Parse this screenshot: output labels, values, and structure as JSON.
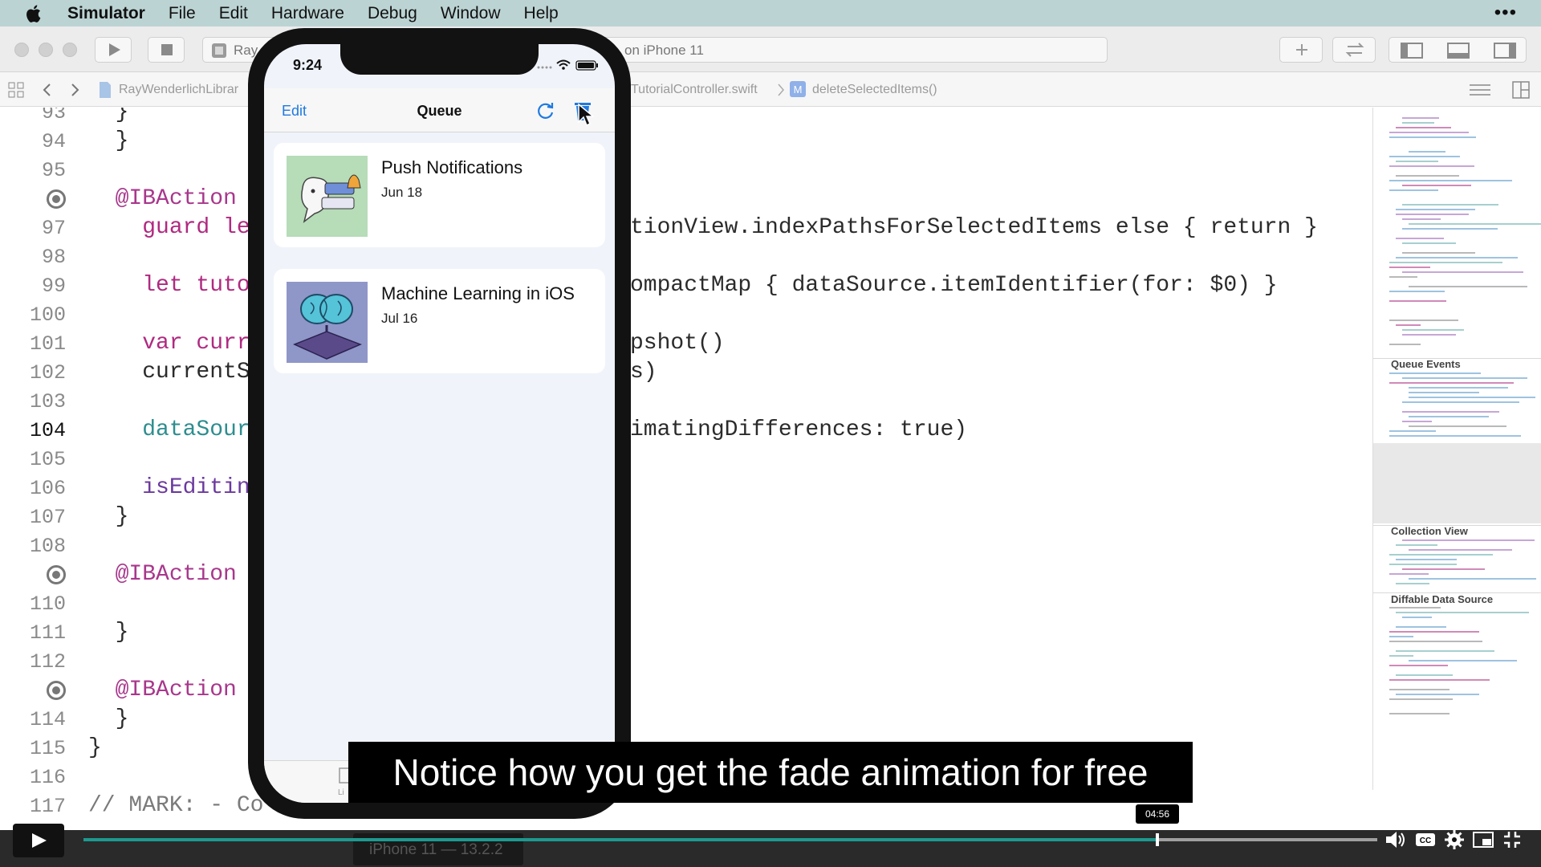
{
  "menubar": {
    "app": "Simulator",
    "items": [
      "File",
      "Edit",
      "Hardware",
      "Debug",
      "Window",
      "Help"
    ]
  },
  "toolbar": {
    "scheme_left": "Ray",
    "scheme_right": "on iPhone 11"
  },
  "jumpbar": {
    "project": "RayWenderlichLibrar",
    "file": "TutorialController.swift",
    "method": "deleteSelectedItems()"
  },
  "editor": {
    "lines": [
      {
        "num": "93",
        "code": "  }",
        "current": false
      },
      {
        "num": "94",
        "code": "  }",
        "current": false
      },
      {
        "num": "95",
        "code": "",
        "current": false
      },
      {
        "num": "96",
        "code": "  @IBAction",
        "current": false,
        "breakpoint": true
      },
      {
        "num": "97",
        "code": "    guard le",
        "tail": "tionView.indexPathsForSelectedItems else { return }",
        "current": false
      },
      {
        "num": "98",
        "code": "",
        "current": false
      },
      {
        "num": "99",
        "code": "    let tuto",
        "tail": "ompactMap { dataSource.itemIdentifier(for: $0) }",
        "current": false
      },
      {
        "num": "100",
        "code": "",
        "current": false
      },
      {
        "num": "101",
        "code": "    var curr",
        "tail": "pshot()",
        "current": false
      },
      {
        "num": "102",
        "code": "    currentS",
        "tail": "s)",
        "current": false
      },
      {
        "num": "103",
        "code": "",
        "current": false
      },
      {
        "num": "104",
        "code": "    dataSour",
        "tail": "imatingDifferences: true)",
        "current": true
      },
      {
        "num": "105",
        "code": "",
        "current": false
      },
      {
        "num": "106",
        "code": "    isEditin",
        "current": false
      },
      {
        "num": "107",
        "code": "  }",
        "current": false
      },
      {
        "num": "108",
        "code": "",
        "current": false
      },
      {
        "num": "109",
        "code": "  @IBAction",
        "current": false,
        "breakpoint": true
      },
      {
        "num": "110",
        "code": "",
        "current": false
      },
      {
        "num": "111",
        "code": "  }",
        "current": false
      },
      {
        "num": "112",
        "code": "",
        "current": false
      },
      {
        "num": "113",
        "code": "  @IBAction",
        "current": false,
        "breakpoint": true
      },
      {
        "num": "114",
        "code": "  }",
        "current": false
      },
      {
        "num": "115",
        "code": "}",
        "current": false
      },
      {
        "num": "116",
        "code": "",
        "current": false
      },
      {
        "num": "117",
        "code": "// MARK: - Co",
        "current": false
      }
    ]
  },
  "minimap": {
    "sections": [
      "Queue Events",
      "Collection View",
      "Diffable Data Source"
    ]
  },
  "phone": {
    "time": "9:24",
    "nav": {
      "edit_label": "Edit",
      "title": "Queue"
    },
    "items": [
      {
        "title": "Push Notifications",
        "date": "Jun 18"
      },
      {
        "title": "Machine Learning in iOS",
        "date": "Jul 16"
      }
    ],
    "tab_label": "Li"
  },
  "debugbar": {
    "device_label": "iPhone 11 — 13.2.2"
  },
  "caption": "Notice how you get the fade animation for free",
  "video": {
    "time_tooltip": "04:56",
    "progress_fraction": 0.83
  },
  "colors": {
    "accent_teal": "#1c9a90",
    "keyword_pink": "#b02a80",
    "ios_blue": "#1f7ae0",
    "menubar_bg": "#bcd3d3"
  }
}
